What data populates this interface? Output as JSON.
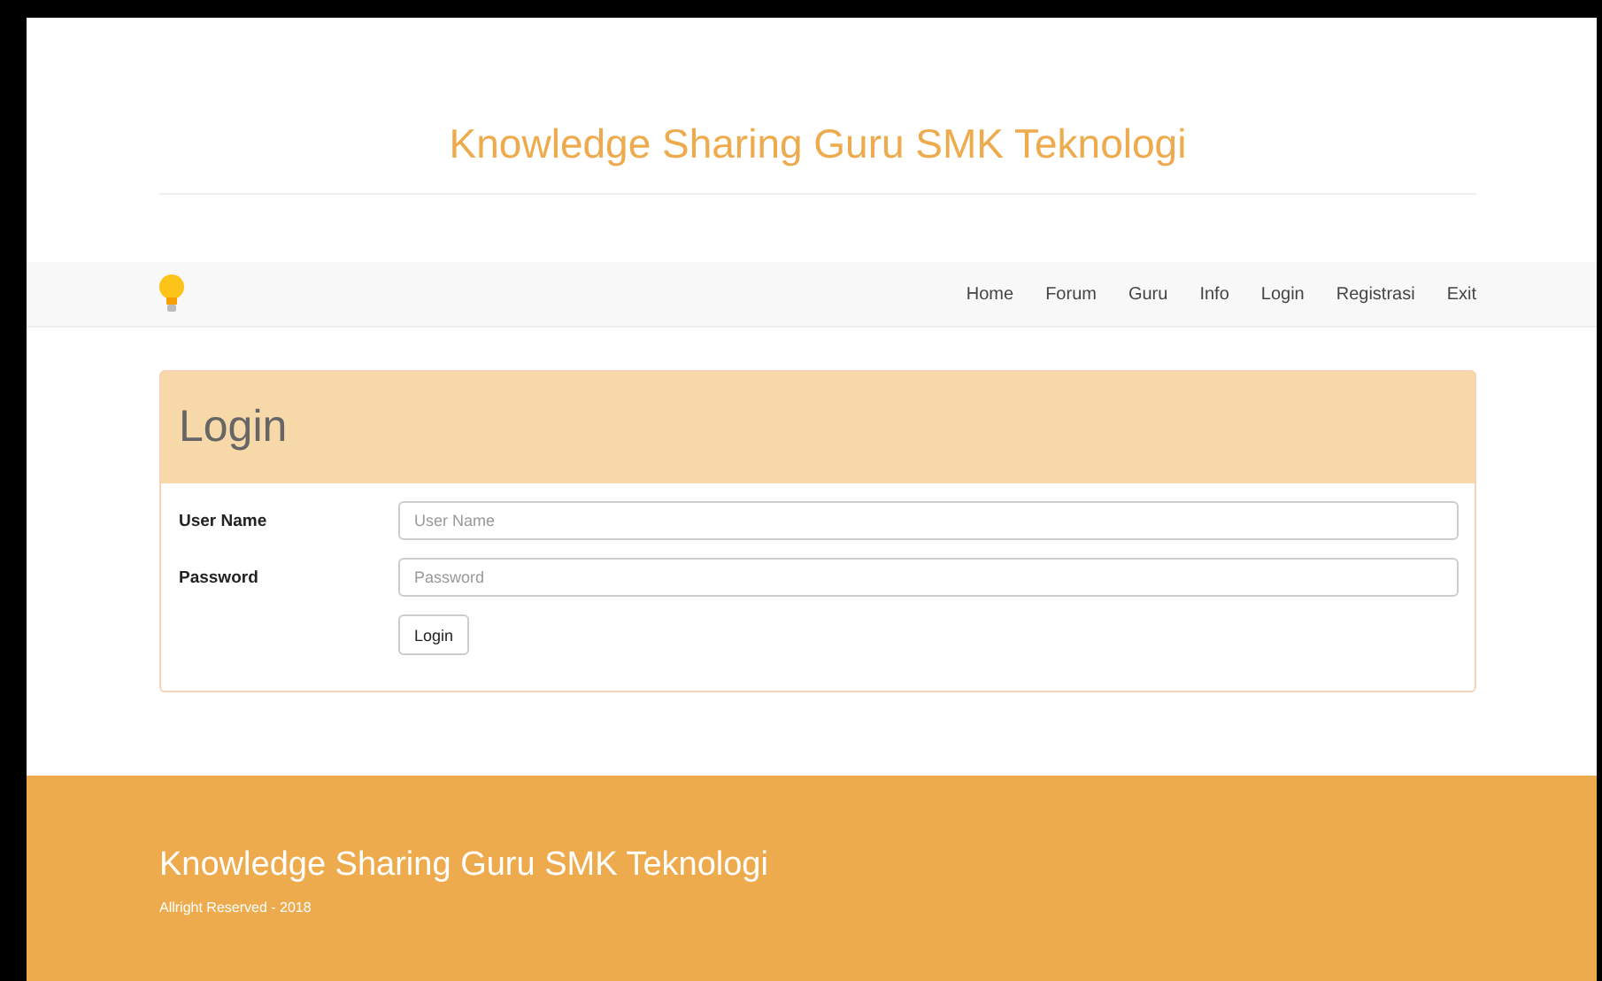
{
  "header": {
    "title": "Knowledge Sharing Guru SMK Teknologi"
  },
  "nav": {
    "items": [
      {
        "label": "Home"
      },
      {
        "label": "Forum"
      },
      {
        "label": "Guru"
      },
      {
        "label": "Info"
      },
      {
        "label": "Login"
      },
      {
        "label": "Registrasi"
      },
      {
        "label": "Exit"
      }
    ]
  },
  "login_panel": {
    "title": "Login",
    "fields": [
      {
        "label": "User Name",
        "placeholder": "User Name"
      },
      {
        "label": "Password",
        "placeholder": "Password"
      }
    ],
    "button": "Login"
  },
  "footer": {
    "title": "Knowledge Sharing Guru SMK Teknologi",
    "copyright": "Allright Reserved - 2018"
  }
}
